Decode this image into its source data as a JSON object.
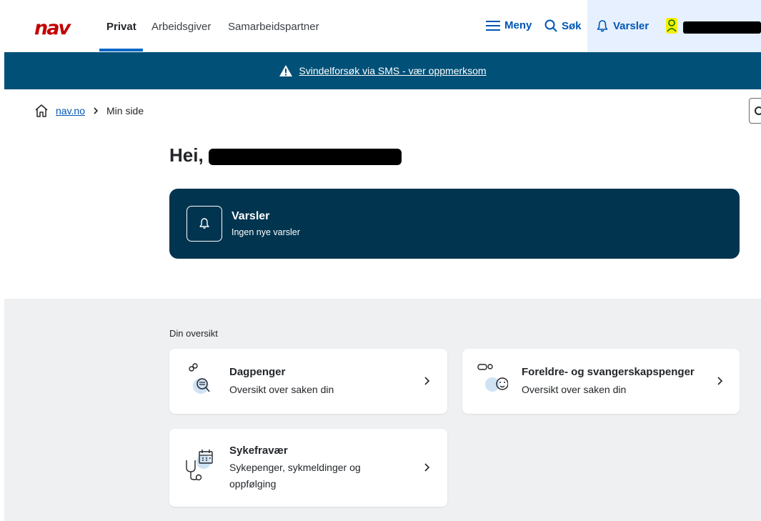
{
  "header": {
    "logo": "nav",
    "tabs": [
      {
        "label": "Privat",
        "active": true
      },
      {
        "label": "Arbeidsgiver",
        "active": false
      },
      {
        "label": "Samarbeidspartner",
        "active": false
      }
    ],
    "menu_label": "Meny",
    "search_label": "Søk",
    "notifications_label": "Varsler"
  },
  "banner": {
    "text": "Svindelforsøk via SMS - vær oppmerksom",
    "icon": "warning-icon"
  },
  "breadcrumb": {
    "home_link": "nav.no",
    "current": "Min side"
  },
  "greeting": "Hei,",
  "varsler_card": {
    "title": "Varsler",
    "subtitle": "Ingen nye varsler"
  },
  "overview": {
    "title": "Din oversikt",
    "cards": [
      {
        "title": "Dagpenger",
        "subtitle": "Oversikt over saken din",
        "icon": "dagpenger-icon"
      },
      {
        "title": "Foreldre- og svangerskapspenger",
        "subtitle": "Oversikt over saken din",
        "icon": "baby-icon"
      },
      {
        "title": "Sykefravær",
        "subtitle": "Sykepenger, sykmeldinger og oppfølging",
        "icon": "stethoscope-calendar-icon"
      }
    ]
  },
  "colors": {
    "brand_red": "#c30000",
    "link_blue": "#0056b4",
    "banner_bg": "#005077",
    "card_dark": "#00344f",
    "overview_bg": "#eff0f1"
  }
}
